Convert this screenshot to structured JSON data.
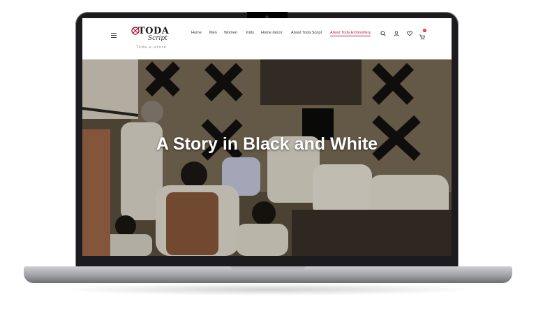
{
  "header": {
    "logo_main": "TODA",
    "logo_script": "Script",
    "logo_tagline": "Toda-e-store",
    "cart_count": "0"
  },
  "nav": {
    "items": [
      "Home",
      "Men",
      "Women",
      "Kids",
      "Home décor",
      "About Toda Script",
      "About Toda Embroidery"
    ],
    "active_index": 6
  },
  "hero": {
    "title": "A Story in Black and White"
  },
  "colors": {
    "accent": "#b0223a",
    "badge": "#dd2222"
  },
  "icons": [
    "menu-icon",
    "search-icon",
    "user-icon",
    "heart-icon",
    "cart-icon"
  ]
}
